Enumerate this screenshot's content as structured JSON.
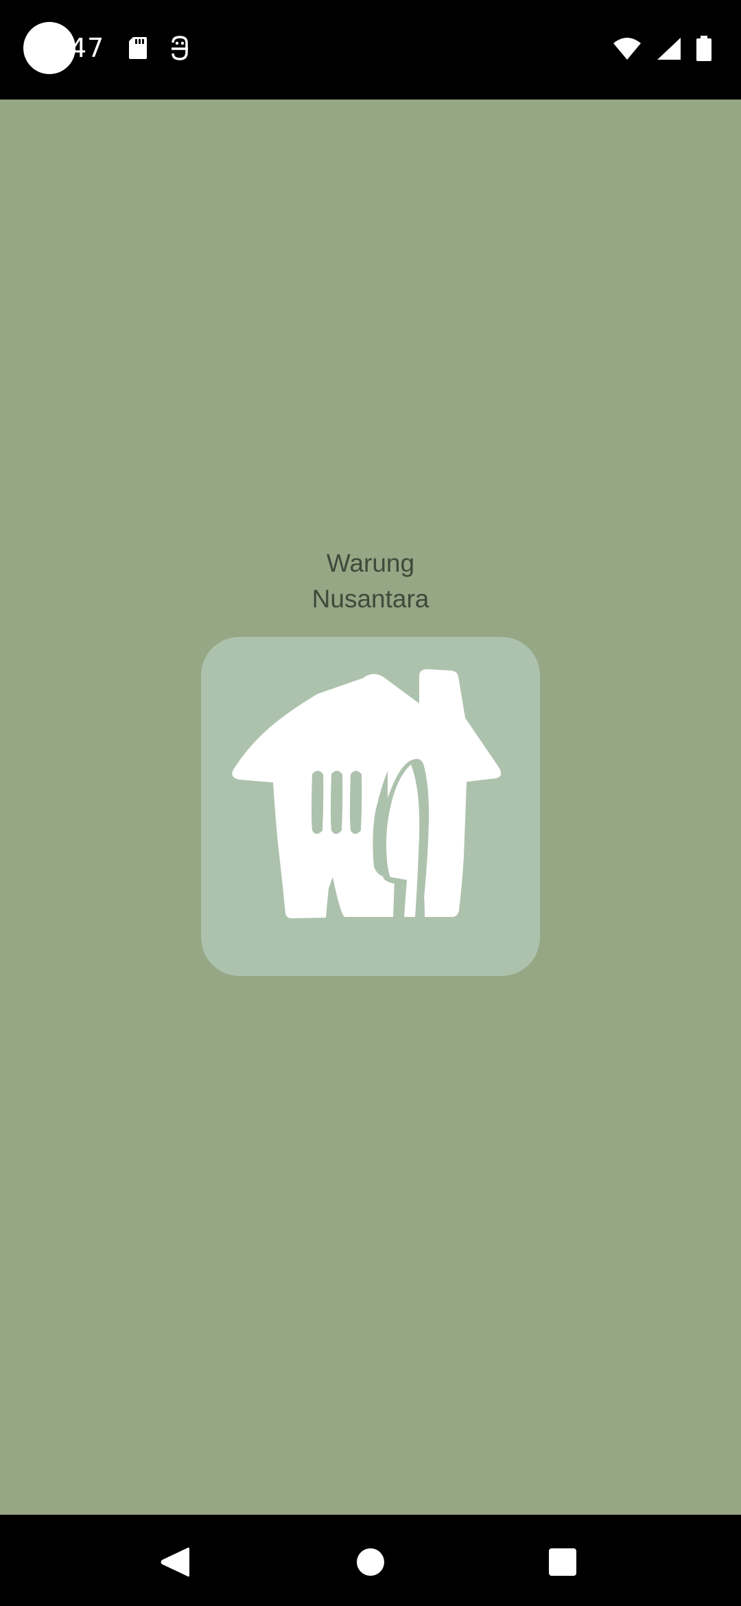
{
  "status_bar": {
    "time": "47",
    "left_icons": [
      "sd-card-icon",
      "face-icon"
    ],
    "right_icons": [
      "wifi-icon",
      "signal-icon",
      "battery-icon"
    ]
  },
  "splash": {
    "app_name_line1": "Warung",
    "app_name_line2": "Nusantara",
    "logo_icon": "house-fork-knife-icon",
    "background_color": "#95a785",
    "tile_color": "#adc2ad"
  },
  "nav_bar": {
    "buttons": [
      "back-icon",
      "home-icon",
      "recents-icon"
    ]
  }
}
